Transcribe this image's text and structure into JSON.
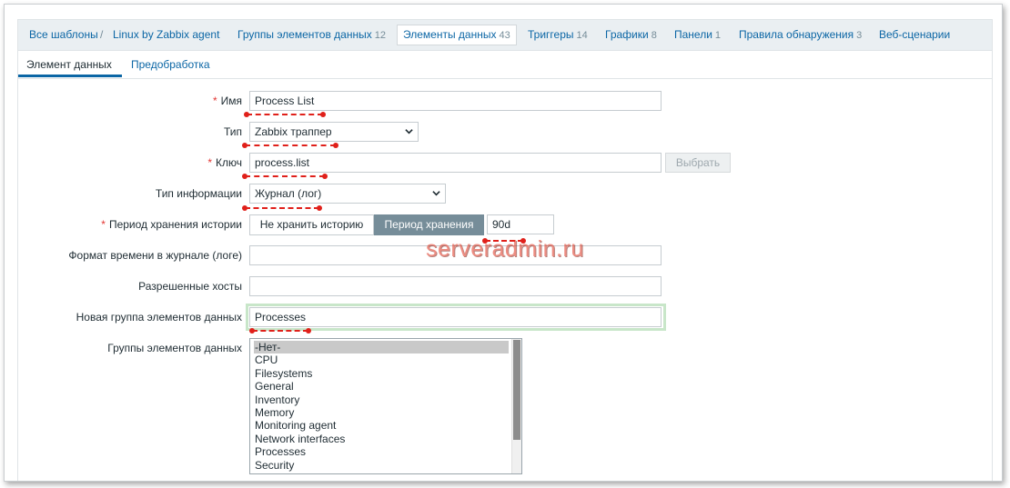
{
  "nav": {
    "all_templates": "Все шаблоны",
    "separator": "/",
    "template": "Linux by Zabbix agent",
    "item_groups": {
      "label": "Группы элементов данных",
      "count": "12"
    },
    "items": {
      "label": "Элементы данных",
      "count": "43"
    },
    "triggers": {
      "label": "Триггеры",
      "count": "14"
    },
    "graphs": {
      "label": "Графики",
      "count": "8"
    },
    "dashboards": {
      "label": "Панели",
      "count": "1"
    },
    "discovery": {
      "label": "Правила обнаружения",
      "count": "3"
    },
    "web": {
      "label": "Веб-сценарии"
    }
  },
  "subtabs": {
    "item": "Элемент данных",
    "preprocessing": "Предобработка"
  },
  "form": {
    "required_mark": "*",
    "name": {
      "label": "Имя",
      "value": "Process List"
    },
    "type": {
      "label": "Тип",
      "value": "Zabbix траппер"
    },
    "key": {
      "label": "Ключ",
      "value": "process.list",
      "select_button": "Выбрать"
    },
    "info_type": {
      "label": "Тип информации",
      "value": "Журнал (лог)"
    },
    "history": {
      "label": "Период хранения истории",
      "option_off": "Не хранить историю",
      "option_on": "Период хранения",
      "value": "90d"
    },
    "log_time_format": {
      "label": "Формат времени в журнале (логе)",
      "value": ""
    },
    "allowed_hosts": {
      "label": "Разрешенные хосты",
      "value": ""
    },
    "new_item_group": {
      "label": "Новая группа элементов данных",
      "value": "Processes"
    },
    "item_groups": {
      "label": "Группы элементов данных",
      "options": [
        "-Нет-",
        "CPU",
        "Filesystems",
        "General",
        "Inventory",
        "Memory",
        "Monitoring agent",
        "Network interfaces",
        "Processes",
        "Security"
      ]
    }
  },
  "watermark": "serveradmin.ru",
  "colors": {
    "link": "#0b66a5",
    "annotation": "#e0201a",
    "accent_green": "#c8e6c9",
    "toggle_on": "#768d99"
  }
}
